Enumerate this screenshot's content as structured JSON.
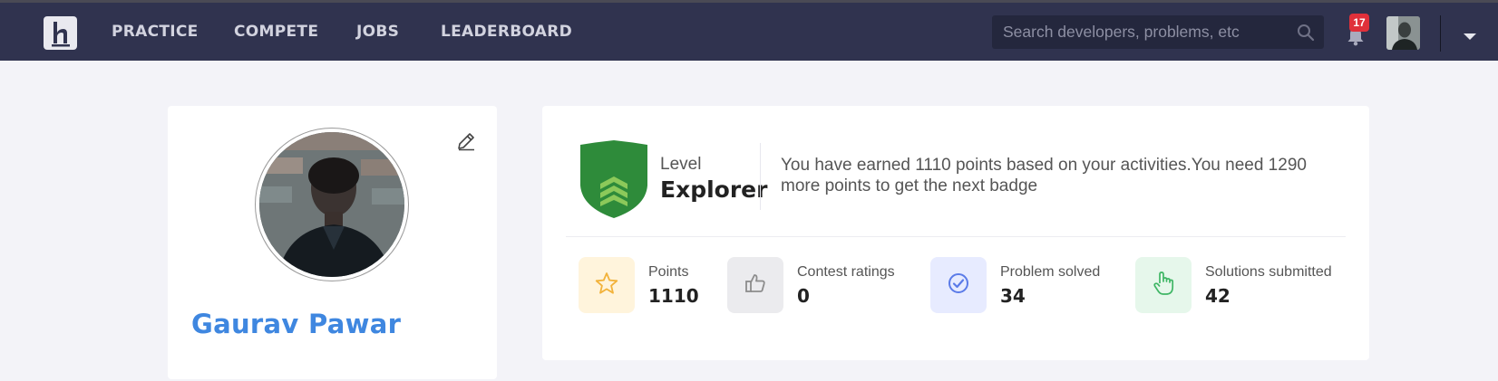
{
  "nav": {
    "logo_icon": "h-logo-icon",
    "items": [
      {
        "label": "PRACTICE"
      },
      {
        "label": "COMPETE"
      },
      {
        "label": "JOBS"
      },
      {
        "label": "LEADERBOARD"
      }
    ],
    "search": {
      "placeholder": "Search developers, problems, etc",
      "value": ""
    },
    "notifications": {
      "count": "17"
    }
  },
  "profile": {
    "name": "Gaurav Pawar"
  },
  "level": {
    "label": "Level",
    "value": "Explorer",
    "message": "You have earned 1110 points based on your activities.You need 1290 more points to get the next badge"
  },
  "stats": [
    {
      "label": "Points",
      "value": "1110",
      "icon": "star-icon",
      "color": "#f2b23a",
      "bg": "#fff4dc"
    },
    {
      "label": "Contest ratings",
      "value": "0",
      "icon": "thumbs-up-icon",
      "color": "#8c8c8c",
      "bg": "#ebebee"
    },
    {
      "label": "Problem solved",
      "value": "34",
      "icon": "check-circle-icon",
      "color": "#5b7be8",
      "bg": "#e7ebff"
    },
    {
      "label": "Solutions submitted",
      "value": "42",
      "icon": "pointer-hand-icon",
      "color": "#3fb665",
      "bg": "#e6f7eb"
    }
  ],
  "colors": {
    "navbar": "#30334f",
    "name_blue": "#3f87e0",
    "badge_red": "#e0303a",
    "shield_green": "#2e8b3a"
  }
}
